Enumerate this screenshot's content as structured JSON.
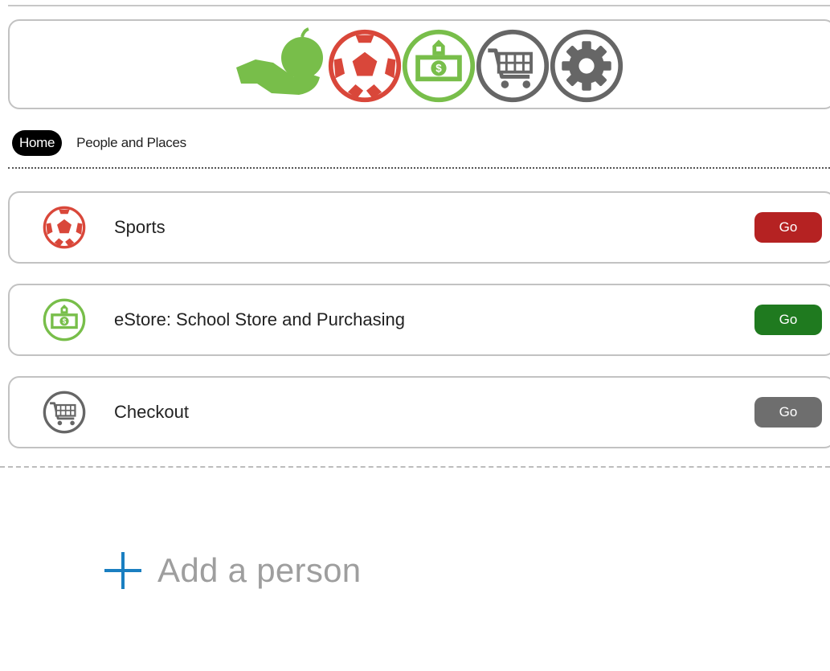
{
  "header": {
    "icons": [
      "apple-hand-icon",
      "soccer-ball-icon",
      "money-bill-icon",
      "shopping-cart-icon",
      "gear-icon"
    ]
  },
  "breadcrumb": {
    "home_label": "Home",
    "people_label": "People and Places"
  },
  "rows": [
    {
      "label": "Sports",
      "icon": "soccer-ball-icon",
      "button_label": "Go",
      "button_color": "#b52222"
    },
    {
      "label": "eStore: School Store and Purchasing",
      "icon": "money-bill-icon",
      "button_label": "Go",
      "button_color": "#1f7a1f"
    },
    {
      "label": "Checkout",
      "icon": "shopping-cart-icon",
      "button_label": "Go",
      "button_color": "#6e6e6e"
    }
  ],
  "add_person": {
    "label": "Add a person"
  },
  "colors": {
    "green": "#78be4a",
    "red": "#d9473a",
    "gray": "#666666",
    "plus_blue": "#1a7fc1"
  }
}
